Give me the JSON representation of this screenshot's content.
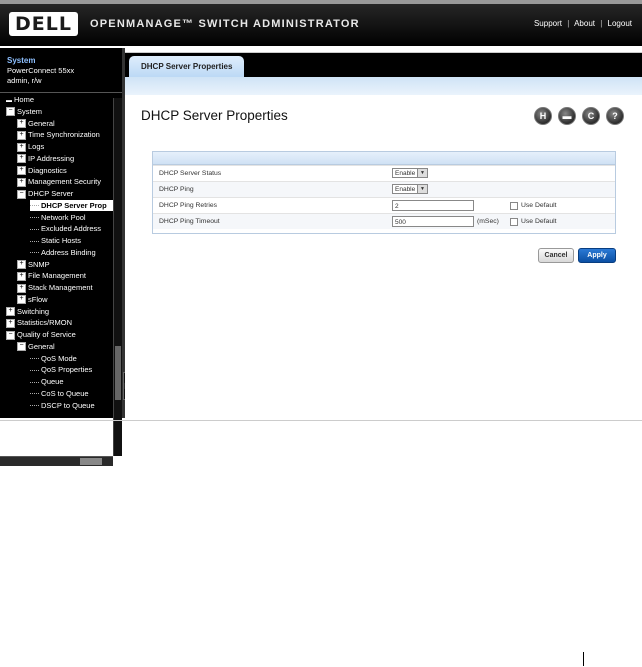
{
  "header": {
    "logo": "DELL",
    "title": "OPENMANAGE™ SWITCH ADMINISTRATOR",
    "links": [
      "Support",
      "About",
      "Logout"
    ],
    "separator": "|"
  },
  "system_info": {
    "title": "System",
    "model": "PowerConnect 55xx",
    "user": "admin, r/w"
  },
  "tree": [
    {
      "label": "Home",
      "expander": "none",
      "level": 0
    },
    {
      "label": "System",
      "expander": "minus",
      "level": 0
    },
    {
      "label": "General",
      "expander": "plus",
      "level": 1
    },
    {
      "label": "Time Synchronization",
      "expander": "plus",
      "level": 1
    },
    {
      "label": "Logs",
      "expander": "plus",
      "level": 1
    },
    {
      "label": "IP Addressing",
      "expander": "plus",
      "level": 1
    },
    {
      "label": "Diagnostics",
      "expander": "plus",
      "level": 1
    },
    {
      "label": "Management Security",
      "expander": "plus",
      "level": 1
    },
    {
      "label": "DHCP Server",
      "expander": "minus",
      "level": 1
    },
    {
      "label": "DHCP Server Prop",
      "expander": "none",
      "level": 2,
      "selected": true
    },
    {
      "label": "Network Pool",
      "expander": "none",
      "level": 2
    },
    {
      "label": "Excluded Address",
      "expander": "none",
      "level": 2
    },
    {
      "label": "Static Hosts",
      "expander": "none",
      "level": 2
    },
    {
      "label": "Address Binding",
      "expander": "none",
      "level": 2
    },
    {
      "label": "SNMP",
      "expander": "plus",
      "level": 1
    },
    {
      "label": "File Management",
      "expander": "plus",
      "level": 1
    },
    {
      "label": "Stack Management",
      "expander": "plus",
      "level": 1
    },
    {
      "label": "sFlow",
      "expander": "plus",
      "level": 1
    },
    {
      "label": "Switching",
      "expander": "plus",
      "level": 0
    },
    {
      "label": "Statistics/RMON",
      "expander": "plus",
      "level": 0
    },
    {
      "label": "Quality of Service",
      "expander": "minus",
      "level": 0
    },
    {
      "label": "General",
      "expander": "minus",
      "level": 1
    },
    {
      "label": "QoS Mode",
      "expander": "none",
      "level": 2
    },
    {
      "label": "QoS Properties",
      "expander": "none",
      "level": 2
    },
    {
      "label": "Queue",
      "expander": "none",
      "level": 2
    },
    {
      "label": "CoS to Queue",
      "expander": "none",
      "level": 2
    },
    {
      "label": "DSCP to Queue",
      "expander": "none",
      "level": 2
    }
  ],
  "main": {
    "tab": "DHCP Server Properties",
    "page_title": "DHCP Server Properties",
    "toolbar_icons": [
      "save-icon",
      "print-icon",
      "refresh-icon",
      "help-icon"
    ],
    "toolbar_glyphs": {
      "save": "H",
      "print": "▬",
      "refresh": "C",
      "help": "?"
    },
    "fields": {
      "server_status": {
        "label": "DHCP Server Status",
        "value": "Enable"
      },
      "ping": {
        "label": "DHCP Ping",
        "value": "Enable"
      },
      "ping_retries": {
        "label": "DHCP Ping Retries",
        "value": "2",
        "use_default_label": "Use Default"
      },
      "ping_timeout": {
        "label": "DHCP Ping Timeout",
        "value": "500",
        "unit": "(mSec)",
        "use_default_label": "Use Default"
      }
    },
    "buttons": {
      "cancel": "Cancel",
      "apply": "Apply"
    }
  }
}
